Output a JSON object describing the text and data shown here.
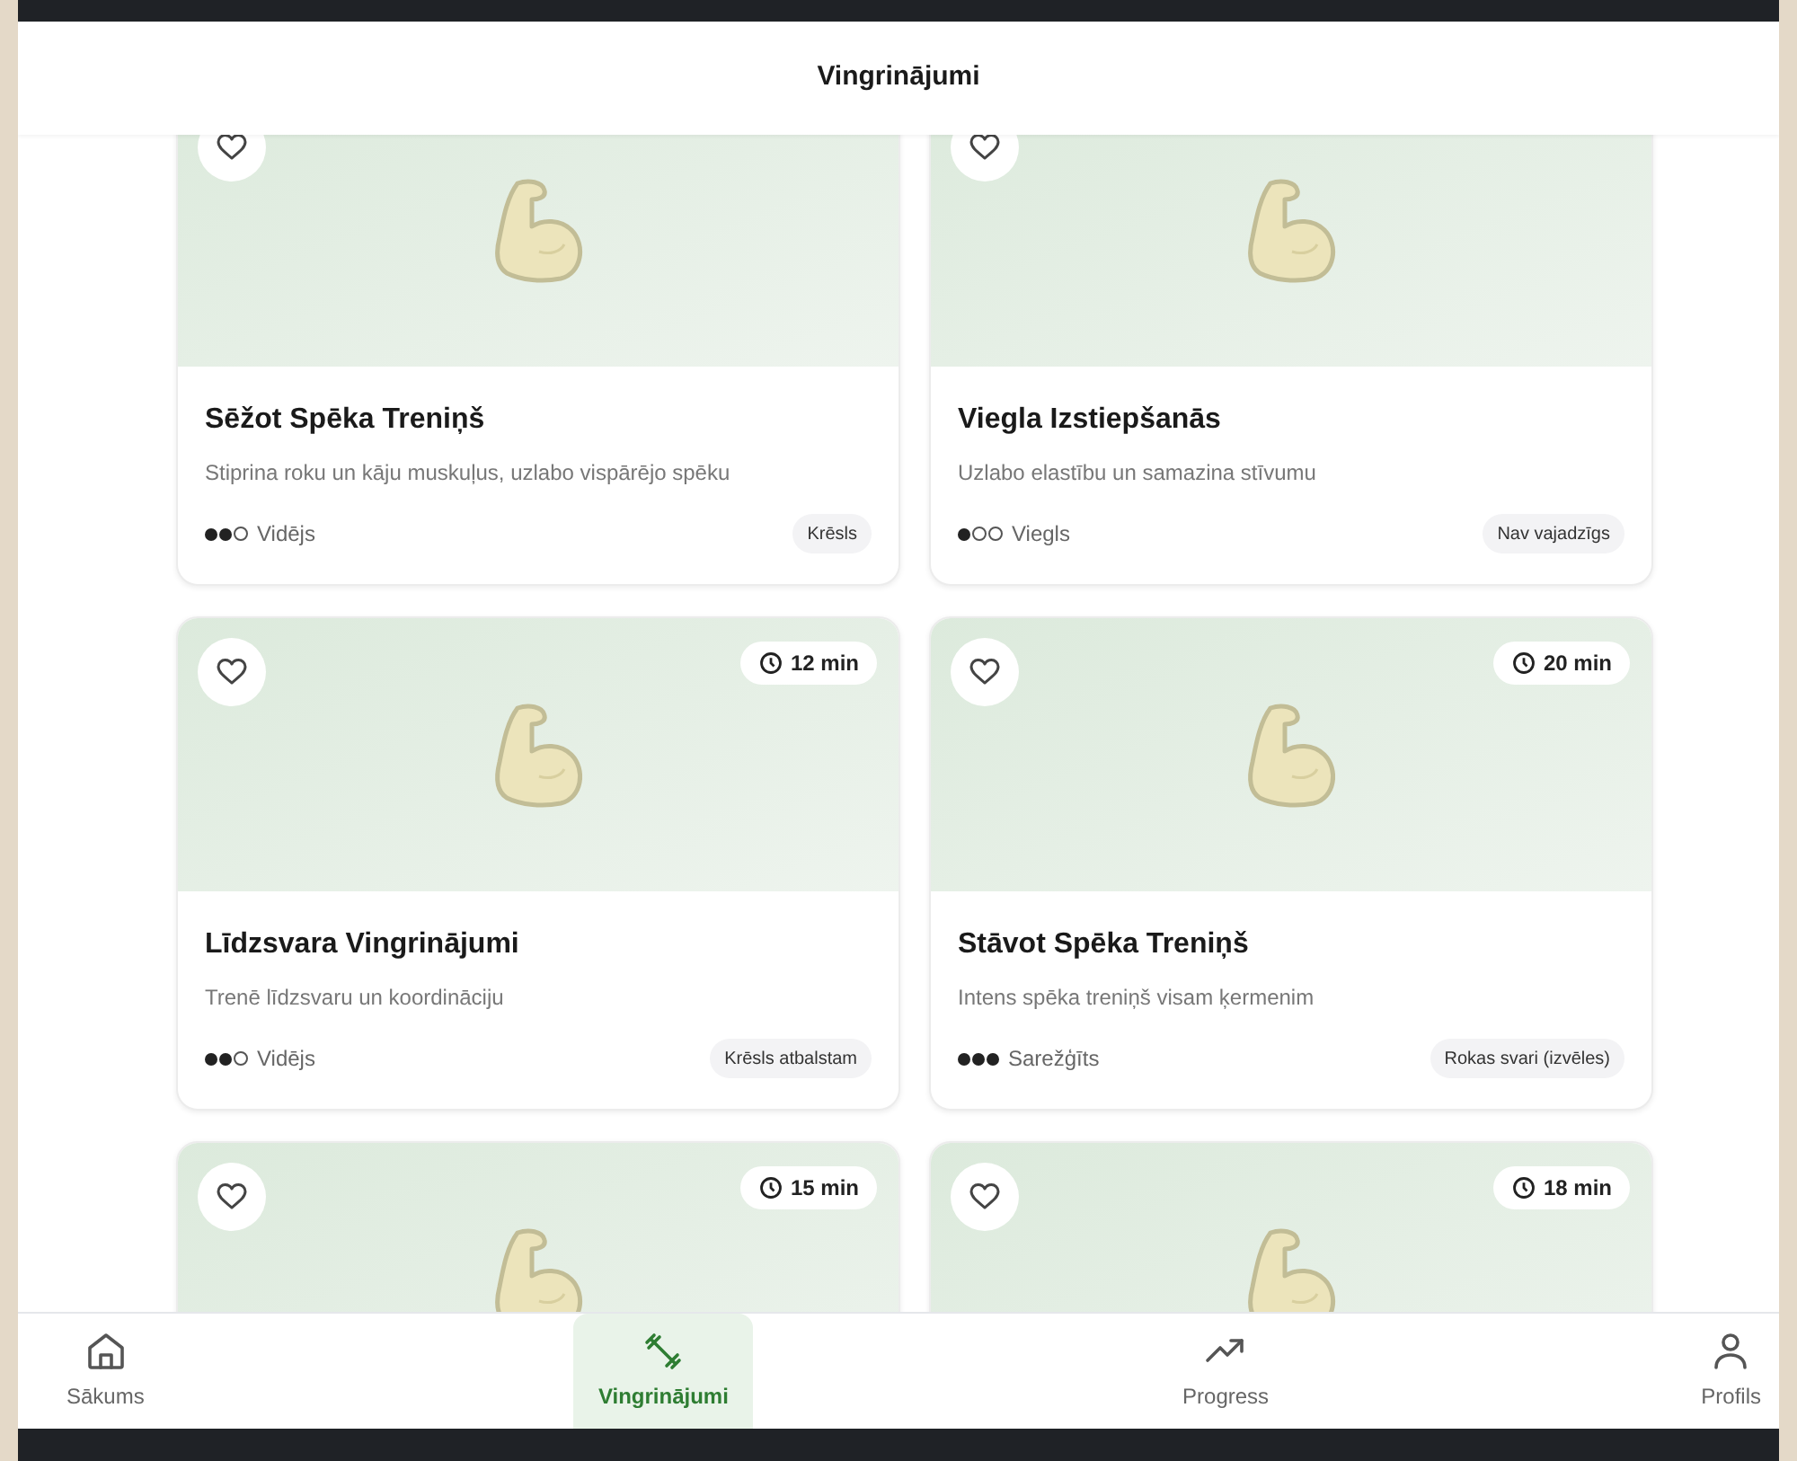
{
  "header": {
    "title": "Vingrinājumi"
  },
  "cards": [
    {
      "favorite": false,
      "title": "Sēžot Spēka Treniņš",
      "description": "Stiprina roku un kāju muskuļus, uzlabo vispārējo spēku",
      "difficulty": "Vidējs",
      "stars": 2,
      "equipment": "Krēsls"
    },
    {
      "favorite": false,
      "title": "Viegla Izstiepšanās",
      "description": "Uzlabo elastību un samazina stīvumu",
      "difficulty": "Viegls",
      "stars": 1,
      "equipment": "Nav vajadzīgs"
    },
    {
      "time": "12 min",
      "favorite": false,
      "title": "Līdzsvara Vingrinājumi",
      "description": "Trenē līdzsvaru un koordināciju",
      "difficulty": "Vidējs",
      "stars": 2,
      "equipment": "Krēsls atbalstam"
    },
    {
      "time": "20 min",
      "favorite": false,
      "title": "Stāvot Spēka Treniņš",
      "description": "Intens spēka treniņš visam ķermenim",
      "difficulty": "Sarežģīts",
      "stars": 3,
      "equipment": "Rokas svari (izvēles)"
    },
    {
      "time": "15 min",
      "favorite": false
    },
    {
      "time": "18 min",
      "favorite": false
    }
  ],
  "nav": [
    {
      "kind": "home",
      "label": "Sākums",
      "selected": false
    },
    {
      "kind": "exercises",
      "label": "Vingrinājumi",
      "selected": true
    },
    {
      "kind": "progress",
      "label": "Progress",
      "selected": false
    },
    {
      "kind": "profile",
      "label": "Profils",
      "selected": false
    }
  ]
}
